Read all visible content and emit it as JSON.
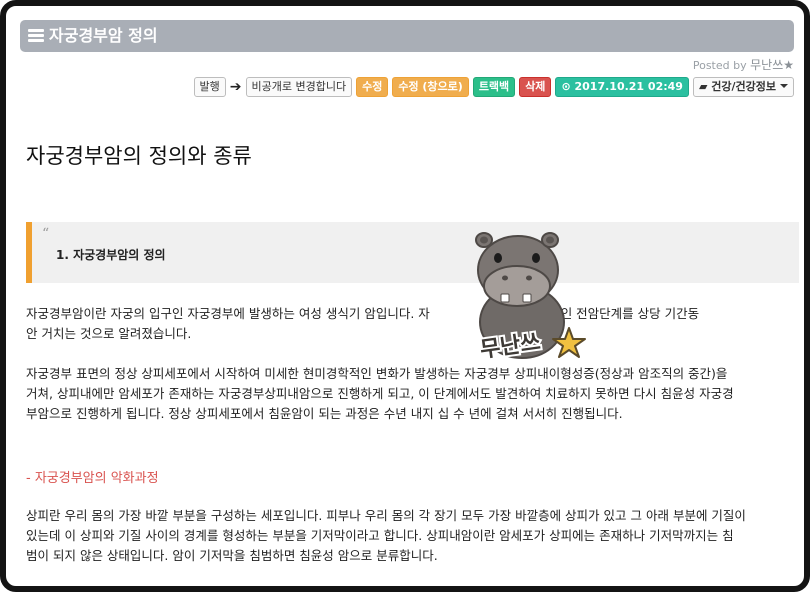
{
  "header": {
    "title": "자궁경부암 정의"
  },
  "posted": {
    "prefix": "Posted by",
    "author": "무난쓰★"
  },
  "toolbar": {
    "publish": "발행",
    "make_private": "비공개로 변경합니다",
    "edit": "수정",
    "edit_window": "수정 (창으로)",
    "trackback": "트랙백",
    "delete": "삭제",
    "datetime": "2017.10.21 02:49",
    "category": "건강/건강정보"
  },
  "article": {
    "heading": "자궁경부암의 정의와 종류",
    "quote": "1. 자궁경부암의 정의",
    "p1_line1": "자궁경부암이란 자궁의 입구인 자궁경부에 발생하는 여성 생식기 암입니다. 자",
    "p1_line1_right": "되기 이전 단계인 전암단계를 상당 기간동",
    "p1_line2": "안 거치는 것으로 알려졌습니다.",
    "p2_line1": "자궁경부 표면의 정상 상피세포에서 시작하여 미세한 현미경학적인 변화가 발생하는 자궁경부 상피내이형성증(정상과 암조직의 중간)을",
    "p2_line2": "거쳐, 상피내에만 암세포가 존재하는 자궁경부상피내암으로 진행하게 되고, 이 단계에서도 발견하여 치료하지 못하면 다시 침윤성 자궁경",
    "p2_line3": "부암으로 진행하게 됩니다. 정상 상피세포에서 침윤암이 되는 과정은 수년 내지 십 수 년에 걸쳐 서서히 진행됩니다.",
    "subheading": "- 자궁경부암의 악화과정",
    "p3_line1": "상피란 우리 몸의 가장 바깥 부분을 구성하는 세포입니다. 피부나 우리 몸의 각 장기 모두 가장 바깥층에 상피가 있고 그 아래 부분에 기질이",
    "p3_line2": "있는데 이 상피와 기질 사이의 경계를 형성하는 부분을 기저막이라고 합니다. 상피내암이란 암세포가 상피에는 존재하나 기저막까지는 침",
    "p3_line3": "범이 되지 않은 상태입니다. 암이 기저막을 침범하면 침윤성 암으로 분류합니다."
  },
  "watermark": {
    "text": "무난쓰",
    "icon": "hippo-mascot-icon"
  },
  "colors": {
    "accent_orange": "#f0ad4e",
    "green": "#2cbf8a",
    "red": "#d9534f",
    "title_bar": "#a9aeb6"
  }
}
